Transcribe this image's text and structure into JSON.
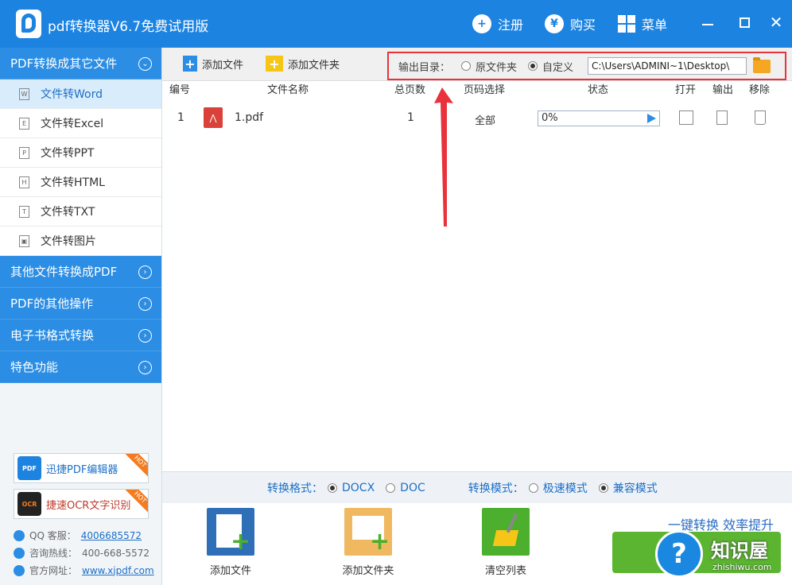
{
  "app": {
    "title": "pdf转换器V6.7免费试用版"
  },
  "titlebar": {
    "register": "注册",
    "buy": "购买",
    "buy_icon": "¥",
    "menu": "菜单"
  },
  "sidebar": {
    "sections": [
      {
        "label": "PDF转换成其它文件",
        "expanded": true
      },
      {
        "label": "其他文件转换成PDF"
      },
      {
        "label": "PDF的其他操作"
      },
      {
        "label": "电子书格式转换"
      },
      {
        "label": "特色功能"
      }
    ],
    "items": [
      {
        "label": "文件转Word",
        "glyph": "W"
      },
      {
        "label": "文件转Excel",
        "glyph": "E"
      },
      {
        "label": "文件转PPT",
        "glyph": "P"
      },
      {
        "label": "文件转HTML",
        "glyph": "H"
      },
      {
        "label": "文件转TXT",
        "glyph": "T"
      },
      {
        "label": "文件转图片",
        "glyph": "▣"
      }
    ],
    "promos": [
      {
        "label": "迅捷PDF编辑器",
        "icon_text": "PDF"
      },
      {
        "label": "捷速OCR文字识别",
        "icon_text": "OCR"
      }
    ],
    "hot": "HOT",
    "contact": {
      "qq_label": "QQ 客服：",
      "qq_value": "4006685572",
      "hotline_label": "咨询热线：",
      "hotline_value": "400-668-5572",
      "site_label": "官方网址：",
      "site_value": "www.xjpdf.com"
    }
  },
  "toolbar": {
    "add_file": "添加文件",
    "add_folder": "添加文件夹",
    "output_dir_label": "输出目录：",
    "opt_source": "原文件夹",
    "opt_custom": "自定义",
    "path_value": "C:\\Users\\ADMINI~1\\Desktop\\"
  },
  "table": {
    "headers": {
      "num": "编号",
      "name": "文件名称",
      "pages": "总页数",
      "range": "页码选择",
      "status": "状态",
      "open": "打开",
      "output": "输出",
      "remove": "移除"
    },
    "rows": [
      {
        "num": "1",
        "name": "1.pdf",
        "pages": "1",
        "range": "全部",
        "progress": "0%"
      }
    ]
  },
  "modes": {
    "format_label": "转换格式：",
    "fmt_docx": "DOCX",
    "fmt_doc": "DOC",
    "mode_label": "转换模式：",
    "mode_fast": "极速模式",
    "mode_compat": "兼容模式"
  },
  "bottom": {
    "add_file": "添加文件",
    "add_folder": "添加文件夹",
    "clear_list": "清空列表",
    "slogan": "一键转换  效率提升"
  },
  "watermark": {
    "title": "知识屋",
    "url": "zhishiwu.com",
    "glyph": "?"
  },
  "colors": {
    "brand": "#1c83e1",
    "sidebar_section": "#2b8de3",
    "highlight": "#e8323c",
    "convert": "#5cb531"
  }
}
